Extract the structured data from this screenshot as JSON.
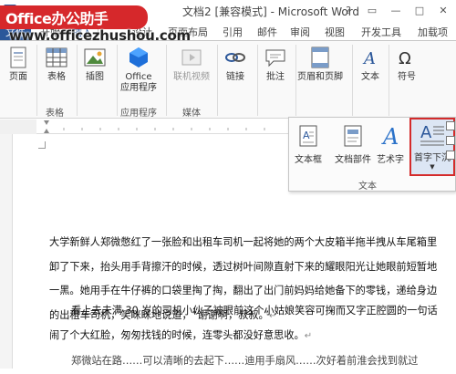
{
  "titlebar": {
    "title": "文档2 [兼容模式] - Microsoft Word",
    "controls": [
      "?",
      "▭",
      "—",
      "□",
      "✕"
    ]
  },
  "watermark": {
    "logo": "Office办公助手",
    "url": "www.officezhushou.com"
  },
  "tabs": {
    "file": "文件",
    "items": [
      "开始",
      "插入",
      "设计",
      "页面布局",
      "引用",
      "邮件",
      "审阅",
      "视图",
      "开发工具",
      "加载项"
    ]
  },
  "ribbon": {
    "pages_label": "页面",
    "table_label": "表格",
    "table_group": "表格",
    "illustrations_label": "插图",
    "office_apps_label_line1": "Office",
    "office_apps_label_line2": "应用程序",
    "apps_group": "应用程序",
    "online_video_label": "联机视频",
    "media_group": "媒体",
    "link_label": "链接",
    "comment_label": "批注",
    "comment_group": "批注",
    "header_footer_label": "页眉和页脚",
    "text_label": "文本",
    "symbol_label": "符号"
  },
  "text_panel": {
    "textbox": "文本框",
    "quickparts": "文档部件",
    "wordart": "艺术字",
    "dropcap": "首字下沉",
    "group": "文本"
  },
  "document": {
    "paragraphs": [
      "大学新鲜人郑微憋红了一张脸和出租车司机一起将她的两个大皮箱半拖半拽从车尾箱里卸了下来，抬头用手背擦汗的时候，透过树叶间隙直射下来的耀眼阳光让她眼前短暂地一黑。她用手在牛仔裤的口袋里掏了掏，翻出了出门前妈妈给她备下的零钱，递给身边的出租车司机，笑眯眯地说道，“谢谢啊，叔叔。”",
      "看上去未满 30 岁的司机小伙子被眼前这个小姑娘笑容可掬而又字正腔圆的一句话闹了个大红脸，匆匆找钱的时候，连零头都没好意思收。",
      "郑微站在路……可以清晰的去起下……迪用手扇风……次好着前淮会找到就过"
    ]
  },
  "colors": {
    "accent": "#2b579a",
    "highlight": "#d42b2b",
    "badge": "#d6282b"
  }
}
